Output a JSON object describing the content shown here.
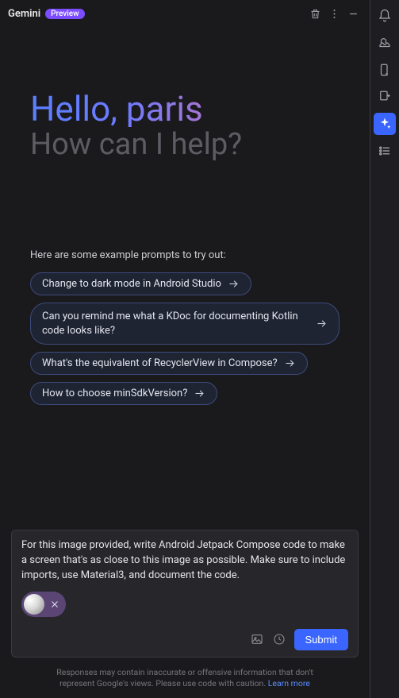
{
  "header": {
    "title": "Gemini",
    "badge": "Preview"
  },
  "greeting": {
    "hello": "Hello, paris",
    "subhead": "How can I help?"
  },
  "prompts": {
    "heading": "Here are some example prompts to try out:",
    "items": [
      "Change to dark mode in Android Studio",
      "Can you remind me what a KDoc for documenting Kotlin code looks like?",
      "What's the equivalent of RecyclerView in Compose?",
      "How to choose minSdkVersion?"
    ]
  },
  "composer": {
    "text": "For this image provided, write Android Jetpack Compose code to make a screen that's as close to this image as possible. Make sure to include imports, use Material3, and document the code.",
    "submit_label": "Submit"
  },
  "footer": {
    "line1": "Responses may contain inaccurate or offensive information that don't",
    "line2_prefix": "represent Google's views. Please use code with caution. ",
    "learn_more": "Learn more"
  }
}
